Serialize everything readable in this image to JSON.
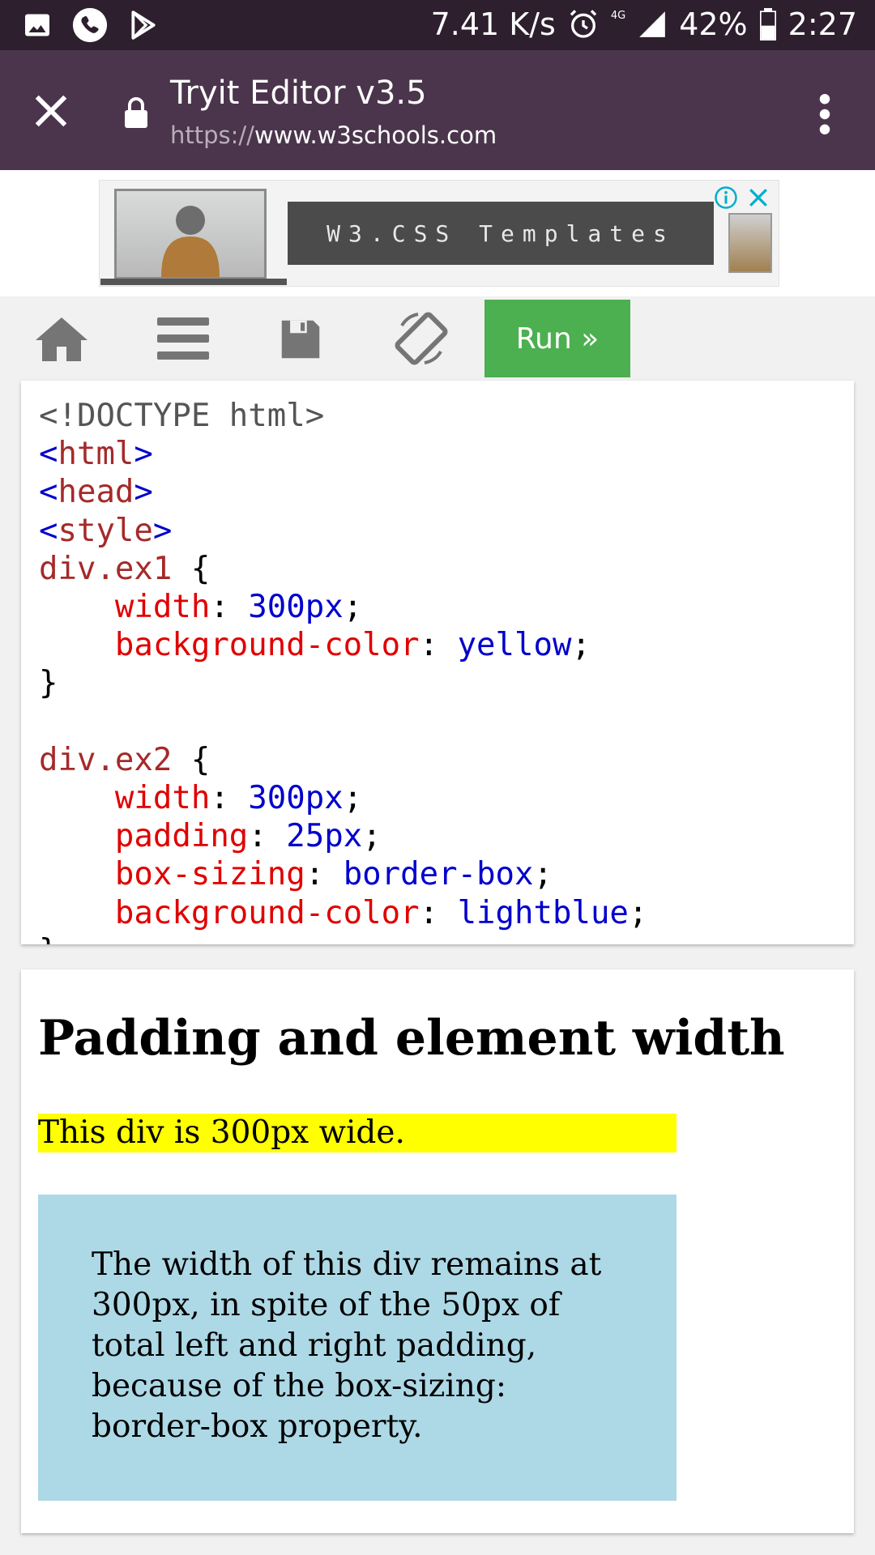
{
  "status_bar": {
    "net_speed": "7.41 K/s",
    "network_type": "4G",
    "battery": "42%",
    "time": "2:27",
    "icons": [
      "image-icon",
      "phone-icon",
      "play-store-icon",
      "alarm-icon",
      "signal-icon",
      "battery-icon"
    ]
  },
  "browser": {
    "page_title": "Tryit Editor v3.5",
    "url_scheme": "https://",
    "url_host": "www.w3schools.com"
  },
  "ad": {
    "banner_text": "W3.CSS Templates"
  },
  "editor_toolbar": {
    "run_label": "Run »"
  },
  "code_lines": [
    [
      {
        "c": "c-plain",
        "t": "<!DOCTYPE html>"
      }
    ],
    [
      {
        "c": "c-tag",
        "t": "<"
      },
      {
        "c": "c-tagname",
        "t": "html"
      },
      {
        "c": "c-tag",
        "t": ">"
      }
    ],
    [
      {
        "c": "c-tag",
        "t": "<"
      },
      {
        "c": "c-tagname",
        "t": "head"
      },
      {
        "c": "c-tag",
        "t": ">"
      }
    ],
    [
      {
        "c": "c-tag",
        "t": "<"
      },
      {
        "c": "c-tagname",
        "t": "style"
      },
      {
        "c": "c-tag",
        "t": ">"
      }
    ],
    [
      {
        "c": "c-sel",
        "t": "div.ex1"
      },
      {
        "c": "",
        "t": " {"
      }
    ],
    [
      {
        "c": "",
        "t": "    "
      },
      {
        "c": "c-prop",
        "t": "width"
      },
      {
        "c": "",
        "t": ": "
      },
      {
        "c": "c-val",
        "t": "300px"
      },
      {
        "c": "",
        "t": ";"
      }
    ],
    [
      {
        "c": "",
        "t": "    "
      },
      {
        "c": "c-prop",
        "t": "background-color"
      },
      {
        "c": "",
        "t": ": "
      },
      {
        "c": "c-val",
        "t": "yellow"
      },
      {
        "c": "",
        "t": ";"
      }
    ],
    [
      {
        "c": "",
        "t": "}"
      }
    ],
    [
      {
        "c": "",
        "t": ""
      }
    ],
    [
      {
        "c": "c-sel",
        "t": "div.ex2"
      },
      {
        "c": "",
        "t": " {"
      }
    ],
    [
      {
        "c": "",
        "t": "    "
      },
      {
        "c": "c-prop",
        "t": "width"
      },
      {
        "c": "",
        "t": ": "
      },
      {
        "c": "c-val",
        "t": "300px"
      },
      {
        "c": "",
        "t": ";"
      }
    ],
    [
      {
        "c": "",
        "t": "    "
      },
      {
        "c": "c-prop",
        "t": "padding"
      },
      {
        "c": "",
        "t": ": "
      },
      {
        "c": "c-val",
        "t": "25px"
      },
      {
        "c": "",
        "t": ";"
      }
    ],
    [
      {
        "c": "",
        "t": "    "
      },
      {
        "c": "c-prop",
        "t": "box-sizing"
      },
      {
        "c": "",
        "t": ": "
      },
      {
        "c": "c-val",
        "t": "border-box"
      },
      {
        "c": "",
        "t": ";"
      }
    ],
    [
      {
        "c": "",
        "t": "    "
      },
      {
        "c": "c-prop",
        "t": "background-color"
      },
      {
        "c": "",
        "t": ": "
      },
      {
        "c": "c-val",
        "t": "lightblue"
      },
      {
        "c": "",
        "t": ";"
      }
    ],
    [
      {
        "c": "",
        "t": "}"
      }
    ]
  ],
  "result": {
    "heading": "Padding and element width",
    "ex1_text": "This div is 300px wide.",
    "ex2_text": "The width of this div remains at 300px, in spite of the 50px of total left and right padding, because of the box-sizing: border-box property."
  },
  "colors": {
    "status_bar": "#2d1f2e",
    "toolbar": "#4b354c",
    "run_button": "#4caf50",
    "ex1_background": "#ffff00",
    "ex2_background": "#add8e6"
  }
}
